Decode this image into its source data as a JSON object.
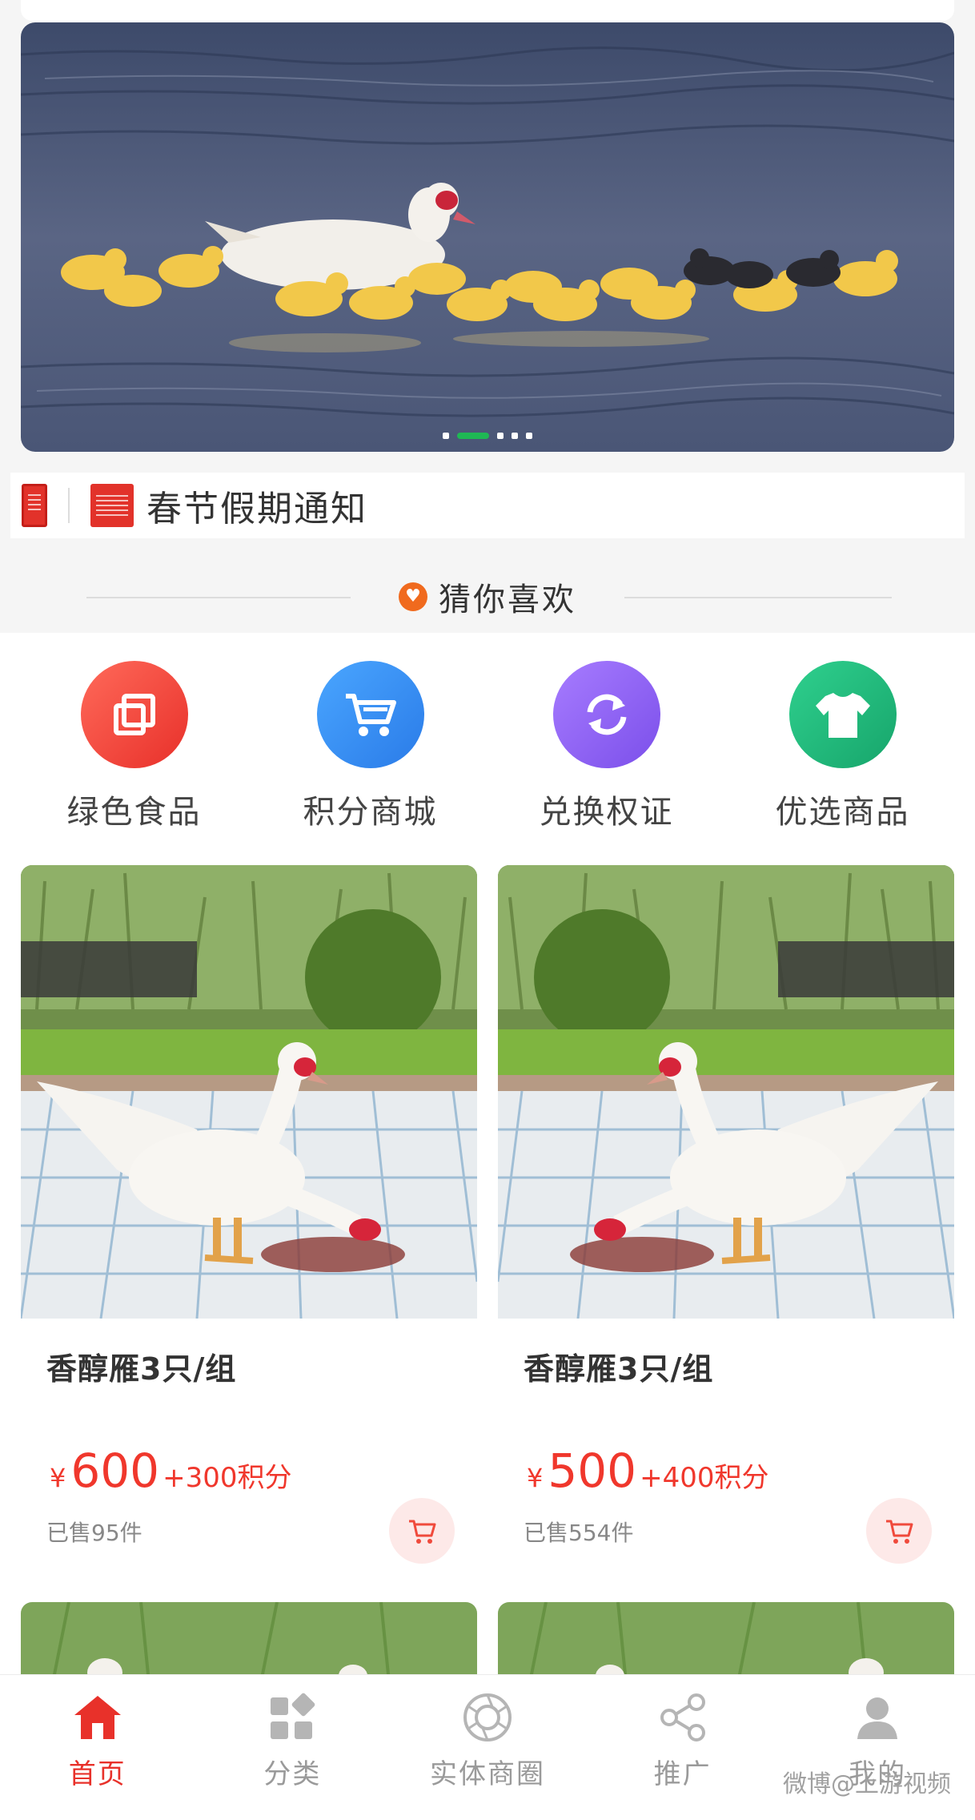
{
  "banner": {
    "dots": 5,
    "active_dot": 1
  },
  "notice": {
    "text": "春节假期通知"
  },
  "section": {
    "title": "猜你喜欢"
  },
  "categories": [
    {
      "label": "绿色食品",
      "icon": "layers-icon",
      "color": "#f0433a"
    },
    {
      "label": "积分商城",
      "icon": "cart-icon",
      "color": "#2f8bf3"
    },
    {
      "label": "兑换权证",
      "icon": "exchange-icon",
      "color": "#8b5cf0"
    },
    {
      "label": "优选商品",
      "icon": "shirt-icon",
      "color": "#1fb37a"
    }
  ],
  "products": [
    {
      "title": "香醇雁3只/组",
      "currency": "¥",
      "price": "600",
      "points": "+300积分",
      "sold": "已售95件"
    },
    {
      "title": "香醇雁3只/组",
      "currency": "¥",
      "price": "500",
      "points": "+400积分",
      "sold": "已售554件"
    }
  ],
  "tabs": [
    {
      "label": "首页",
      "icon": "home-icon",
      "active": true
    },
    {
      "label": "分类",
      "icon": "category-icon"
    },
    {
      "label": "实体商圈",
      "icon": "shutter-icon"
    },
    {
      "label": "推广",
      "icon": "share-icon"
    },
    {
      "label": "我的",
      "icon": "user-icon"
    }
  ],
  "watermark": "微博@上游视频",
  "colors": {
    "accent": "#e8312a",
    "price": "#f0372c"
  }
}
